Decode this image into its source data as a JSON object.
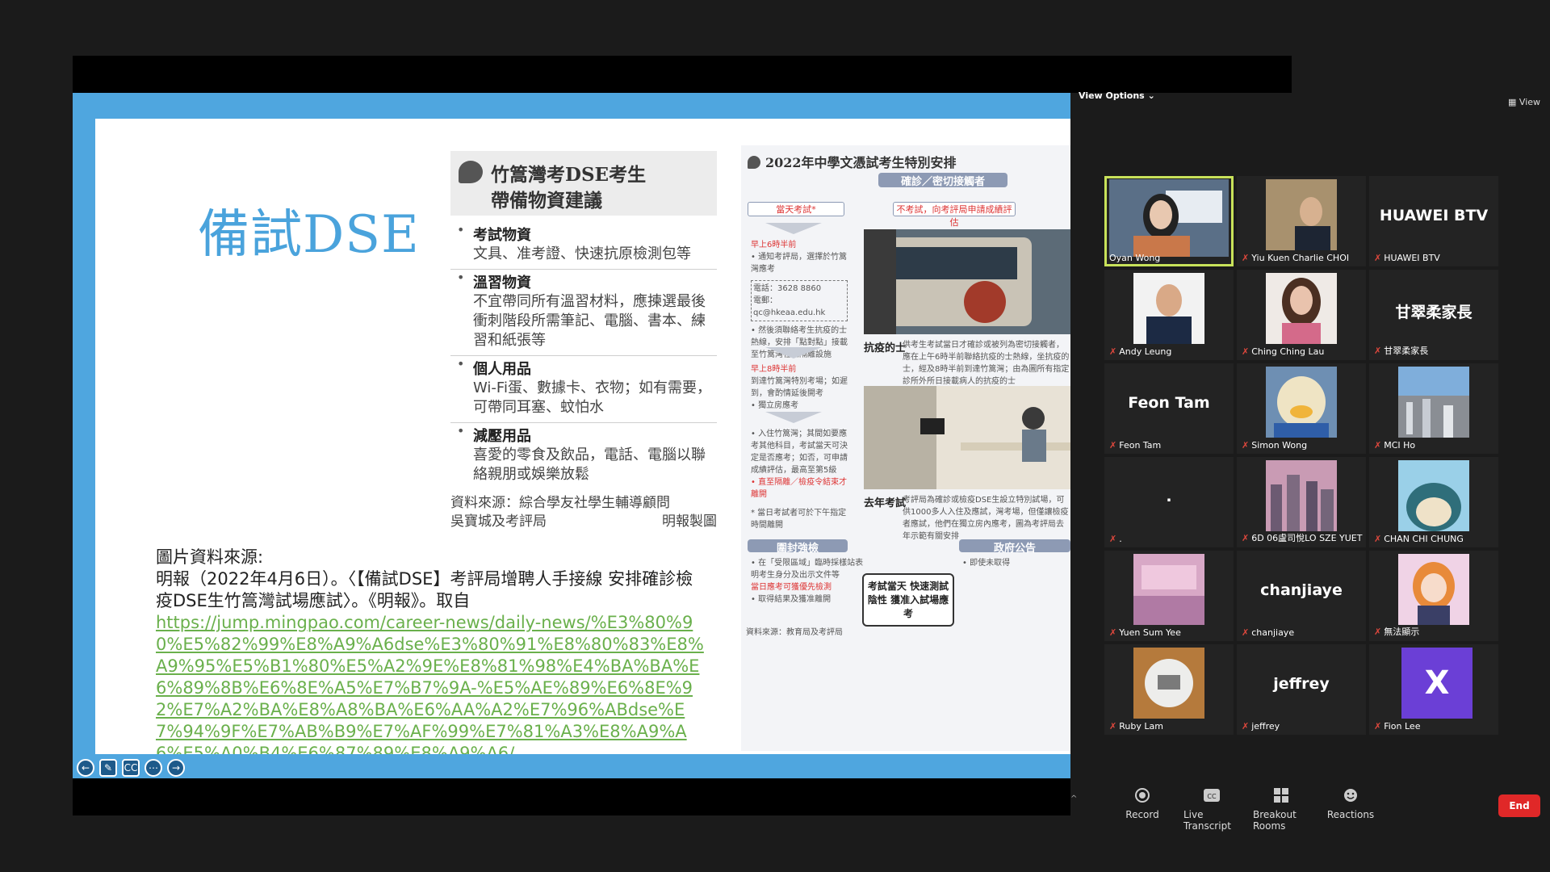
{
  "slide": {
    "title": "備試DSE",
    "card": {
      "heading_line1": "竹篙灣考DSE考生",
      "heading_line2": "帶備物資建議",
      "items": [
        {
          "title": "考試物資",
          "text": "文具、准考證、快速抗原檢測包等"
        },
        {
          "title": "溫習物資",
          "text": "不宜帶同所有溫習材料，應揀選最後衝刺階段所需筆記、電腦、書本、練習和紙張等"
        },
        {
          "title": "個人用品",
          "text": "Wi-Fi蛋、數據卡、衣物；如有需要，可帶同耳塞、蚊怕水"
        },
        {
          "title": "減壓用品",
          "text": "喜愛的零食及飲品，電話、電腦以聯絡親朋或娛樂放鬆"
        }
      ],
      "source_line1": "資料來源：綜合學友社學生輔導顧問",
      "source_line2_left": "吳寶城及考評局",
      "source_line2_right": "明報製圖"
    },
    "image_source": {
      "label": "圖片資料來源:",
      "citation": "明報（2022年4月6日）。〈【備試DSE】考評局增聘人手接線 安排確診檢疫DSE生竹篙灣試場應試〉。《明報》。取自",
      "link": "https://jump.mingpao.com/career-news/daily-news/%E3%80%90%E5%82%99%E8%A9%A6dse%E3%80%91%E8%80%83%E8%A9%95%E5%B1%80%E5%A2%9E%E8%81%98%E4%BA%BA%E6%89%8B%E6%8E%A5%E7%B7%9A-%E5%AE%89%E6%8E%92%E7%A2%BA%E8%A8%BA%E6%AA%A2%E7%96%ABdse%E7%94%9F%E7%AB%B9%E7%AF%99%E7%81%A3%E8%A9%A6%E5%A0%B4%E6%87%89%E8%A9%A6/"
    },
    "infographic": {
      "title": "2022年中學文憑試考生特別安排",
      "pill_top": "確診／密切接觸者",
      "box_exam_day": "當天考試*",
      "box_no_exam": "不考試，向考評局申請成績評估",
      "note_6am_title": "早上6時半前",
      "note_6am": "• 通知考評局，選擇於竹篙灣應考",
      "phone": "電話：3628 8860",
      "email": "電郵：qc@hkeaa.edu.hk",
      "note_transport": "• 然後須聯絡考生抗疫的士熱線，安排「點對點」接載至竹篙灣社區隔離設施",
      "note_8am_title": "早上8時半前",
      "note_8am": "到達竹篙灣特別考場；如遲到，會酌情延後開考",
      "note_room": "• 獨立房應考",
      "note_stay": "• 入住竹篙灣；其間如要應考其他科目，考試當天可決定是否應考；如否，可申請成績評估，最高至第5級",
      "note_isolation": "• 直至隔離／檢疫令結束才離開",
      "note_afternoon": "* 當日考試者可於下午指定時間離開",
      "label_taxi": "抗疫的士",
      "taxi_text": "供考生考試當日才確診或被列為密切接觸者，應在上午6時半前聯絡抗疫的士熱線，坐抗疫的士，經及8時半前到達竹篙灣；由為圖所有指定診所外所日接載病人的抗疫的士",
      "label_last_year": "去年考試",
      "last_year_text": "考評局為確診或檢疫DSE生設立特別試場，可供1000多人入住及應試，灣考場，但僅讓檢疫者應試，他們在獨立房內應考，圖為考評局去年示範有關安排",
      "pill_bottom_left": "圍封強檢",
      "pill_bottom_right": "政府公告",
      "bottom_note1": "• 在「受限區域」臨時採樣站表明考生身分及出示文件等",
      "bottom_note2": "當日應考可獲優先檢測",
      "bottom_note3": "• 取得結果及獲准離開",
      "bottom_right_note": "• 即使未取得",
      "box_center": "考試當天 快速測試陰性 獲准入試場應考",
      "source": "資料來源：教育局及考評局"
    }
  },
  "panel": {
    "view_options": "View Options",
    "view_button": "View",
    "participants": [
      {
        "name": "Oyan Wong",
        "type": "video",
        "active": true
      },
      {
        "name": "Yiu Kuen Charlie CHOI",
        "type": "video"
      },
      {
        "name": "HUAWEI BTV",
        "type": "name",
        "display": "HUAWEI BTV"
      },
      {
        "name": "Andy Leung",
        "type": "video"
      },
      {
        "name": "Ching Ching Lau",
        "type": "video"
      },
      {
        "name": "甘翠柔家長",
        "type": "name",
        "display": "甘翠柔家長"
      },
      {
        "name": "Feon Tam",
        "type": "name",
        "display": "Feon Tam"
      },
      {
        "name": "Simon Wong",
        "type": "video"
      },
      {
        "name": "MCI Ho",
        "type": "video"
      },
      {
        "name": ".",
        "type": "name",
        "display": "."
      },
      {
        "name": "6D 06盧司悅LO SZE YUET",
        "type": "video"
      },
      {
        "name": "CHAN CHI CHUNG",
        "type": "video"
      },
      {
        "name": "Yuen Sum Yee",
        "type": "video"
      },
      {
        "name": "chanjiaye",
        "type": "name",
        "display": "chanjiaye"
      },
      {
        "name": "無法顯示",
        "type": "video"
      },
      {
        "name": "Ruby Lam",
        "type": "video"
      },
      {
        "name": "jeffrey",
        "type": "name",
        "display": "jeffrey"
      },
      {
        "name": "Fion Lee",
        "type": "avatar",
        "display": "X"
      }
    ],
    "toolbar": {
      "record": "Record",
      "transcript": "Live Transcript",
      "breakout": "Breakout Rooms",
      "reactions": "Reactions",
      "end": "End"
    }
  }
}
